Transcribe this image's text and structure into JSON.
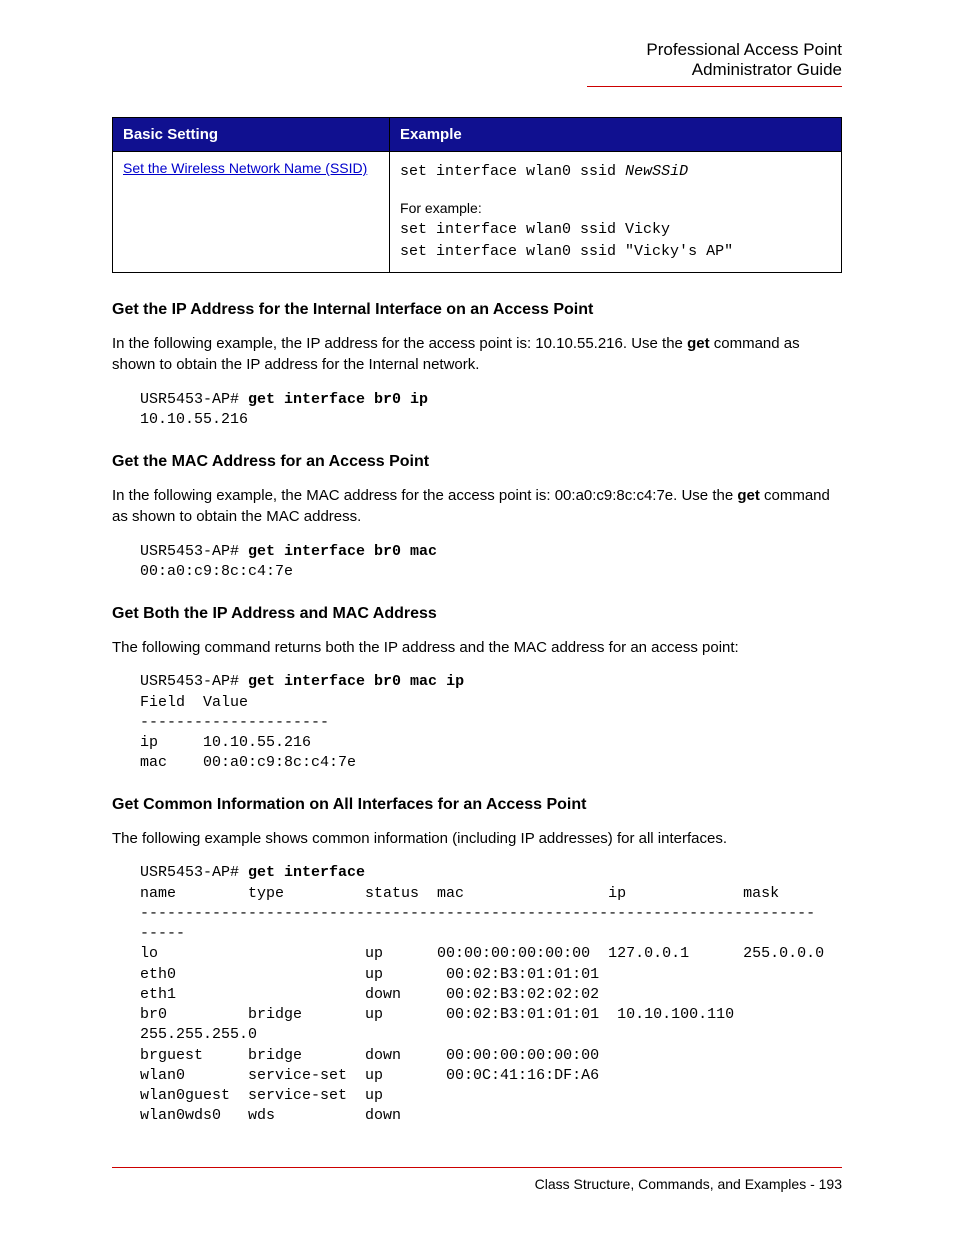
{
  "header": {
    "line1": "Professional Access Point",
    "line2": "Administrator Guide"
  },
  "table": {
    "headers": {
      "col1": "Basic Setting",
      "col2": "Example"
    },
    "row": {
      "linkText": "Set the Wireless Network Name (SSID)",
      "cmdPrefix": "set interface wlan0 ssid ",
      "cmdItalic": "NewSSiD",
      "forExample": "For example:",
      "ex1": "set interface wlan0 ssid Vicky",
      "ex2": "set interface wlan0 ssid \"Vicky's AP\""
    }
  },
  "sect1": {
    "title": "Get the IP Address for the Internal Interface on an Access Point",
    "p_a": "In the following example, the IP address for the access point is: 10.10.55.216. Use the ",
    "p_b": "get",
    "p_c": " command as shown to obtain the IP address for the Internal network.",
    "prePrompt": "USR5453-AP# ",
    "preCmd": "get interface br0 ip",
    "preOut": "10.10.55.216"
  },
  "sect2": {
    "title": "Get the MAC Address for an Access Point",
    "p_a": "In the following example, the MAC address for the access point is: 00:a0:c9:8c:c4:7e. Use the ",
    "p_b": "get",
    "p_c": " command as shown to obtain the MAC address.",
    "prePrompt": "USR5453-AP# ",
    "preCmd": "get interface br0 mac",
    "preOut": "00:a0:c9:8c:c4:7e"
  },
  "sect3": {
    "title": "Get Both the IP Address and MAC Address",
    "p": "The following command returns both the IP address and the MAC address for an access point:",
    "prePrompt": "USR5453-AP# ",
    "preCmd": "get interface br0 mac ip",
    "preOut": "Field  Value\n---------------------\nip     10.10.55.216\nmac    00:a0:c9:8c:c4:7e"
  },
  "sect4": {
    "title": "Get Common Information on All Interfaces for an Access Point",
    "p": "The following example shows common information (including IP addresses) for all interfaces.",
    "prePrompt": "USR5453-AP# ",
    "preCmd": "get interface",
    "preOut": "name        type         status  mac                ip             mask\n---------------------------------------------------------------------------\n-----\nlo                       up      00:00:00:00:00:00  127.0.0.1      255.0.0.0\neth0                     up       00:02:B3:01:01:01\neth1                     down     00:02:B3:02:02:02\nbr0         bridge       up       00:02:B3:01:01:01  10.10.100.110\n255.255.255.0\nbrguest     bridge       down     00:00:00:00:00:00\nwlan0       service-set  up       00:0C:41:16:DF:A6\nwlan0guest  service-set  up\nwlan0wds0   wds          down"
  },
  "footer": {
    "text": "Class Structure, Commands, and Examples - 193"
  }
}
